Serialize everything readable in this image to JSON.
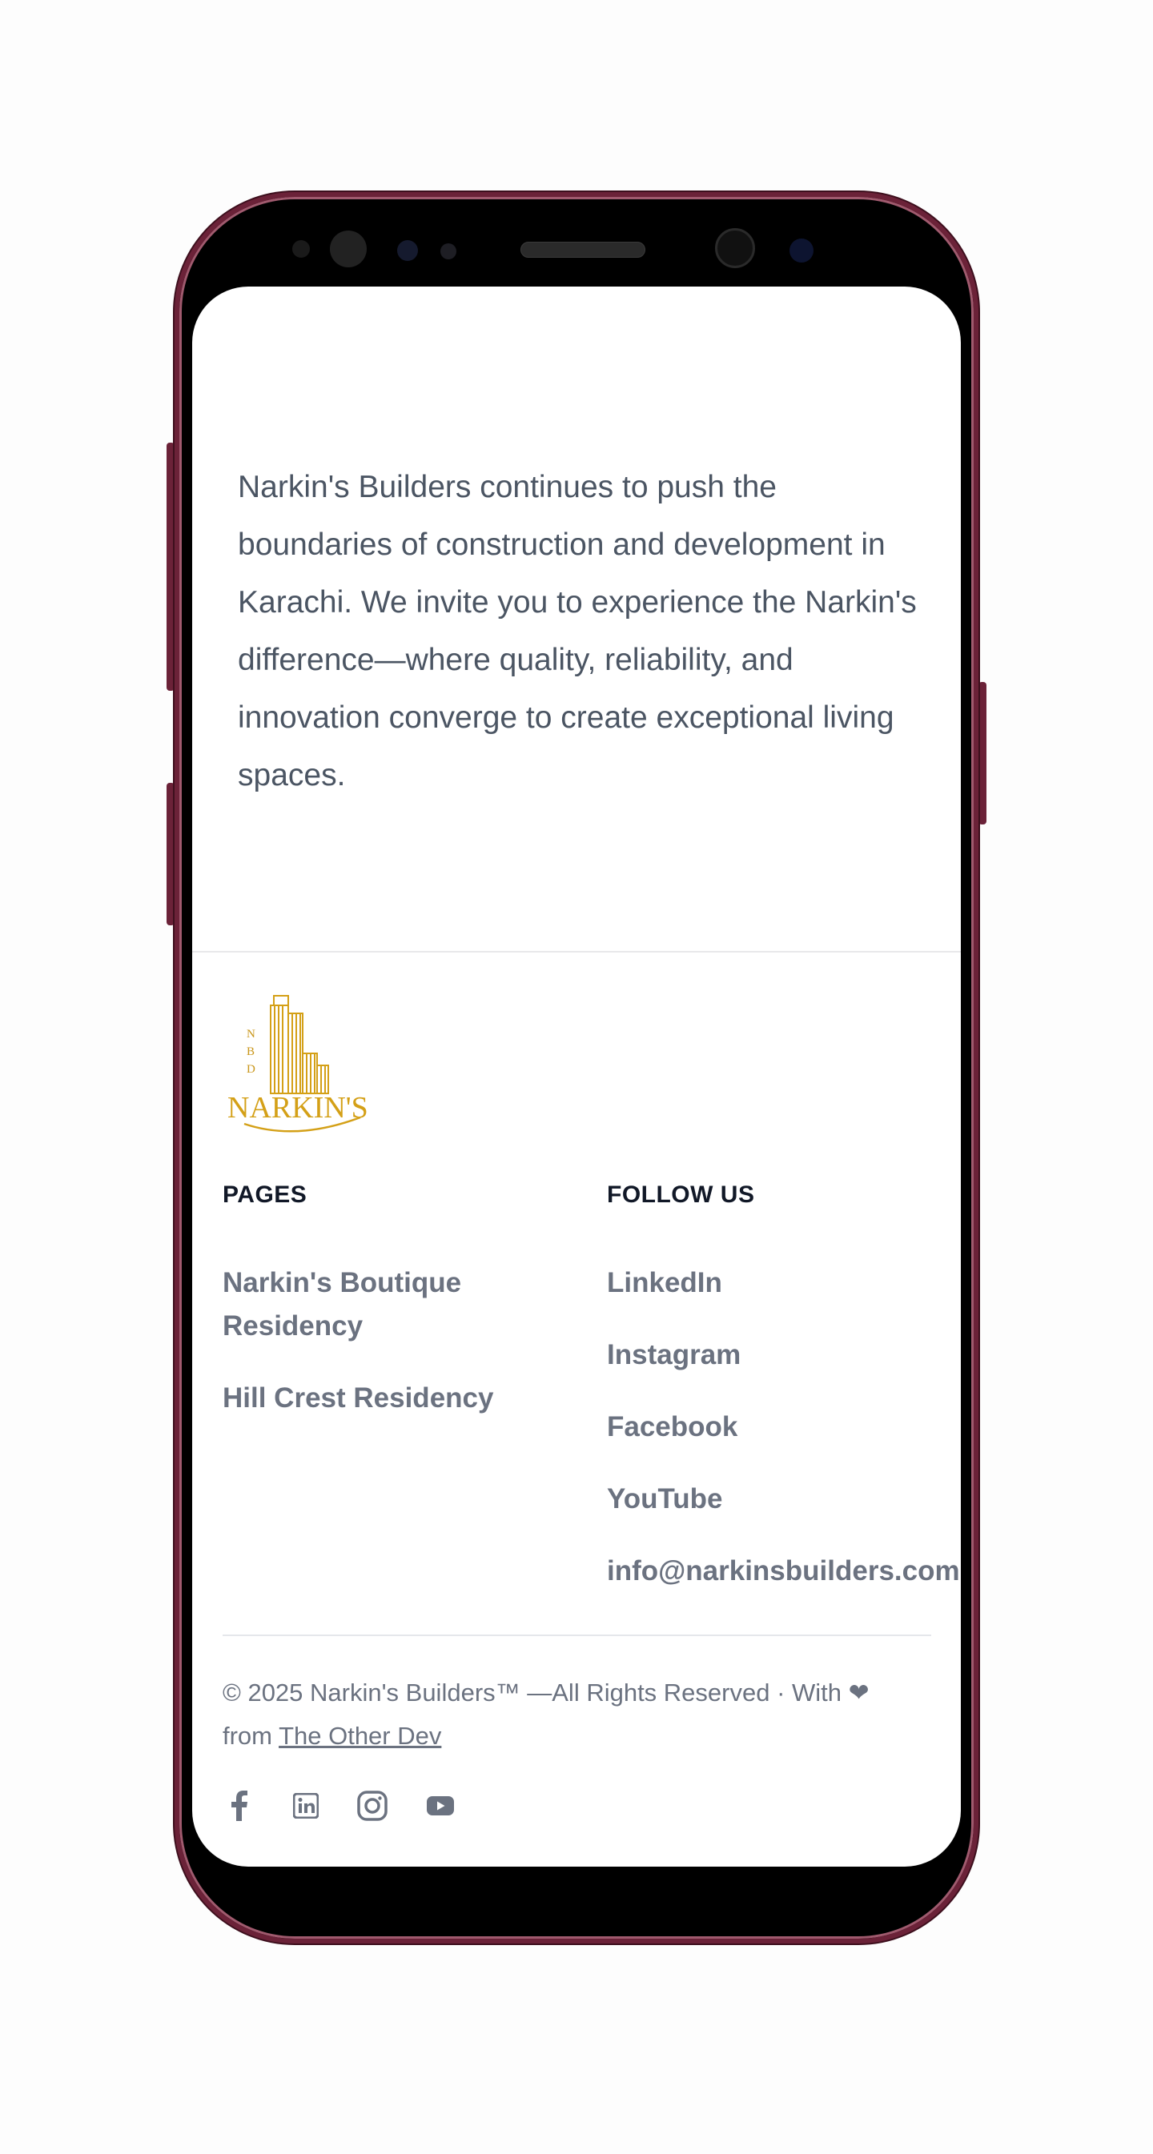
{
  "intro_text": "Narkin's Builders continues to push the boundaries of construction and development in Karachi. We invite you to experience the Narkin's difference—where quality, reliability, and innovation converge to create exceptional living spaces.",
  "logo": {
    "wordmark": "NARKIN'S",
    "monogram": [
      "N",
      "B",
      "D"
    ]
  },
  "pages": {
    "title": "PAGES",
    "links": [
      "Narkin's Boutique",
      "Residency",
      "Hill Crest Residency"
    ]
  },
  "follow": {
    "title": "FOLLOW US",
    "links": [
      "LinkedIn",
      "Instagram",
      "Facebook",
      "YouTube",
      "info@narkinsbuilders.com"
    ]
  },
  "footer": {
    "copyright_prefix": "© 2025 Narkin's Builders™ —All Rights Reserved · With",
    "heart": "❤",
    "from": "from",
    "credit": "The Other Dev"
  },
  "social_icons": [
    "facebook-icon",
    "linkedin-icon",
    "instagram-icon",
    "youtube-icon"
  ],
  "colors": {
    "frame": "#6b2238",
    "text": "#4b5563",
    "link": "#6b7280",
    "logo_gold": "#d4a017"
  }
}
